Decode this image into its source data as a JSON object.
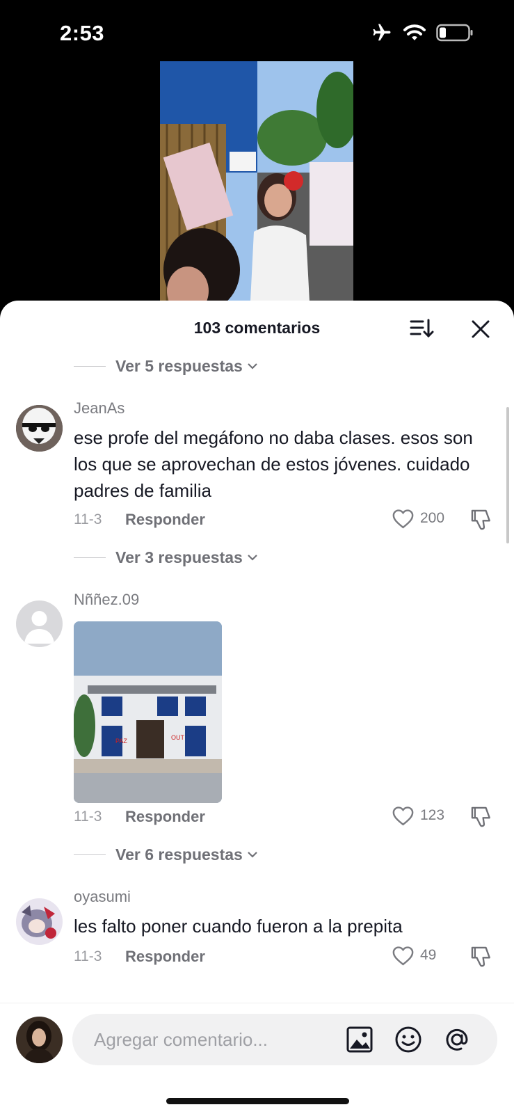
{
  "status_bar": {
    "time": "2:53",
    "icons": [
      "airplane-icon",
      "wifi-icon",
      "battery-icon"
    ]
  },
  "header": {
    "title": "103 comentarios"
  },
  "thread": [
    {
      "replies_label": "Ver 5 respuestas"
    },
    {
      "username": "JeanAs",
      "text": "ese profe del megáfono no daba clases. esos son los que se aprovechan de estos jóvenes. cuidado padres de familia",
      "date": "11-3",
      "reply_label": "Responder",
      "likes": "200",
      "replies_label": "Ver 3 respuestas"
    },
    {
      "username": "Nññez.09",
      "image": "photo-of-burned-building",
      "date": "11-3",
      "reply_label": "Responder",
      "likes": "123",
      "replies_label": "Ver 6 respuestas"
    },
    {
      "username": "oyasumi",
      "text": "les falto poner cuando fueron a la prepita",
      "date": "11-3",
      "reply_label": "Responder",
      "likes": "49"
    }
  ],
  "composer": {
    "placeholder": "Agregar comentario..."
  },
  "colors": {
    "text": "#161823",
    "muted": "#7a7b80",
    "background": "#ffffff"
  }
}
